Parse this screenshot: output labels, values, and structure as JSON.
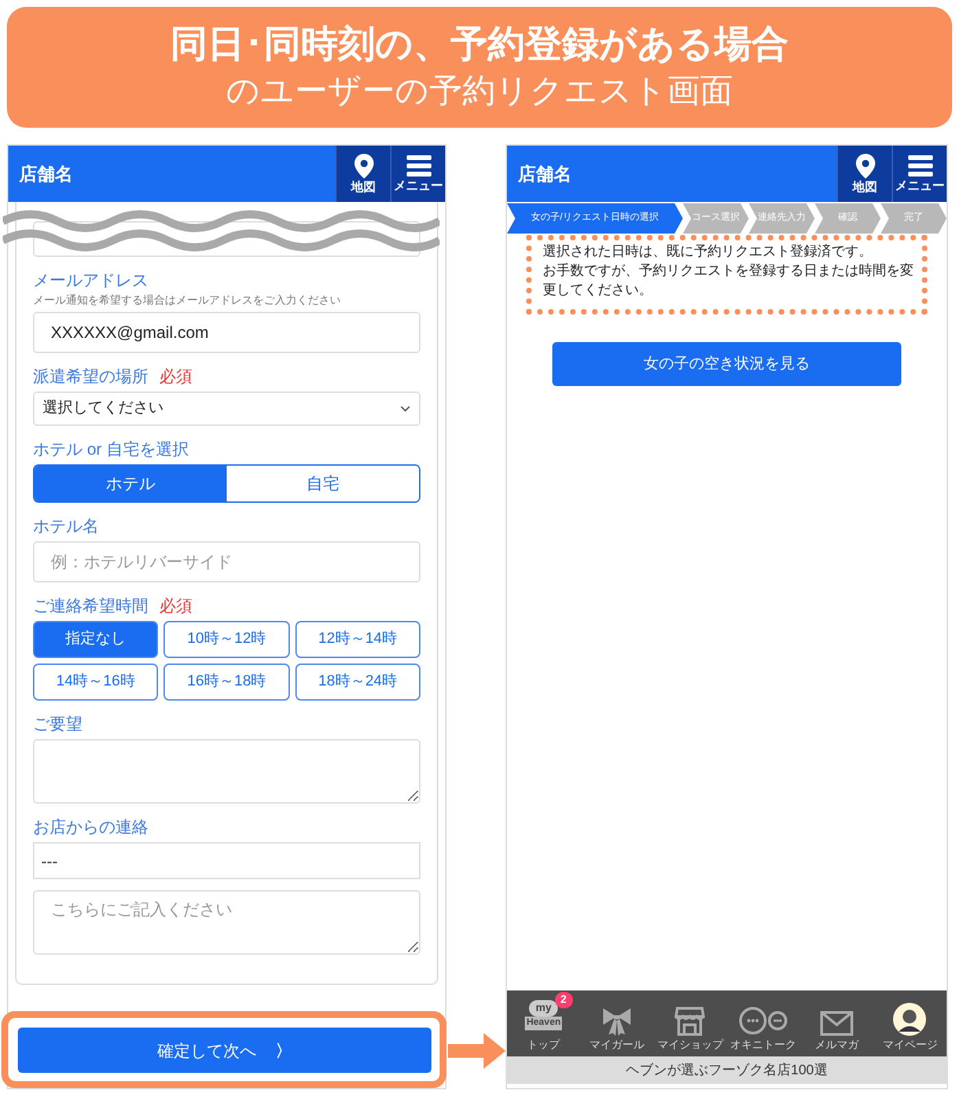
{
  "title": {
    "line1": "同日･同時刻の、予約登録がある場合",
    "line2": "のユーザーの予約リクエスト画面"
  },
  "left_screen": {
    "header": {
      "store_name": "店舗名",
      "buttons": [
        {
          "label": "地図",
          "kind": "pin"
        },
        {
          "label": "メニュー",
          "kind": "menu"
        }
      ]
    },
    "email": {
      "label": "メールアドレス",
      "hint": "メール通知を希望する場合はメールアドレスをご入力ください",
      "value": "XXXXXX@gmail.com"
    },
    "place": {
      "label": "派遣希望の場所",
      "required": "必須",
      "value": "選択してください"
    },
    "place_type": {
      "label": "ホテル or 自宅を選択",
      "options": [
        {
          "label": "ホテル",
          "selected": true
        },
        {
          "label": "自宅",
          "selected": false
        }
      ]
    },
    "hotel_name": {
      "label": "ホテル名",
      "placeholder": "例：ホテルリバーサイド"
    },
    "contact_time": {
      "label": "ご連絡希望時間",
      "required": "必須",
      "options": [
        {
          "label": "指定なし",
          "selected": true
        },
        {
          "label": "10時～12時",
          "selected": false
        },
        {
          "label": "12時～14時",
          "selected": false
        },
        {
          "label": "14時～16時",
          "selected": false
        },
        {
          "label": "16時～18時",
          "selected": false
        },
        {
          "label": "18時～24時",
          "selected": false
        }
      ]
    },
    "request": {
      "label": "ご要望"
    },
    "shop_message": {
      "label": "お店からの連絡",
      "value": "---",
      "reply_placeholder": "こちらにご記入ください"
    },
    "submit_button": {
      "label": "確定して次へ",
      "arrow": "〉"
    }
  },
  "right_screen": {
    "header": {
      "store_name": "店舗名",
      "buttons": [
        {
          "label": "地図",
          "kind": "pin"
        },
        {
          "label": "メニュー",
          "kind": "menu"
        }
      ]
    },
    "steps": [
      {
        "label": "女の子/リクエスト日時の選択",
        "selected": true
      },
      {
        "label": "コース選択",
        "selected": false
      },
      {
        "label": "連絡先入力",
        "selected": false
      },
      {
        "label": "確認",
        "selected": false
      },
      {
        "label": "完了",
        "selected": false
      }
    ],
    "notice": [
      "選択された日時は、既に予約リクエスト登録済です。",
      "お手数ですが、予約リクエストを登録する日または時間を変更してください。"
    ],
    "availability_button": "女の子の空き状況を見る",
    "bottom_nav": [
      {
        "kind": "logo",
        "label": "トップ",
        "logo_top": "my",
        "logo_bottom": "Heaven",
        "badge": "2"
      },
      {
        "kind": "ribbon",
        "label": "マイガール"
      },
      {
        "kind": "shop",
        "label": "マイショップ"
      },
      {
        "kind": "chat",
        "label": "オキニトーク"
      },
      {
        "kind": "mail",
        "label": "メルマガ"
      },
      {
        "kind": "avatar",
        "label": "マイページ"
      }
    ],
    "footer_banner": "ヘブンが選ぶフーゾク名店100選"
  }
}
